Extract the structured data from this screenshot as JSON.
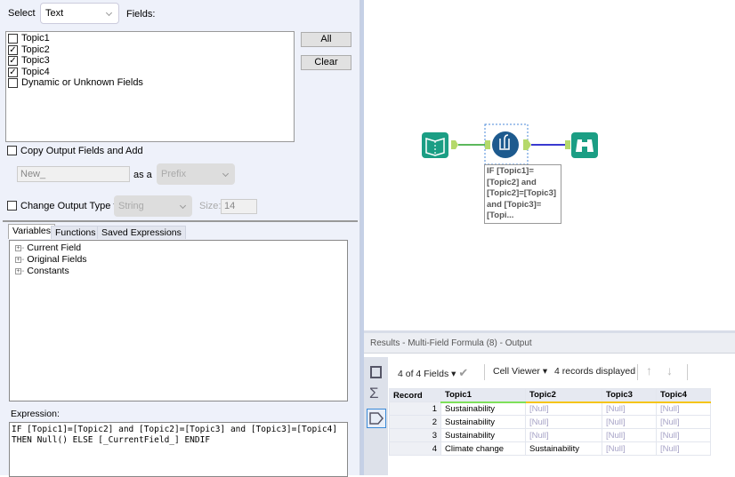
{
  "config": {
    "select_label": "Select",
    "select_value": "Text",
    "fields_label": "Fields:",
    "fields": [
      {
        "label": "Topic1",
        "checked": false
      },
      {
        "label": "Topic2",
        "checked": true
      },
      {
        "label": "Topic3",
        "checked": true
      },
      {
        "label": "Topic4",
        "checked": true
      },
      {
        "label": "Dynamic or Unknown Fields",
        "checked": false
      }
    ],
    "all_button": "All",
    "clear_button": "Clear",
    "copy_output_label": "Copy Output Fields and Add",
    "copy_output_checked": false,
    "new_field_value": "New_",
    "as_a_label": "as a",
    "prefix_value": "Prefix",
    "change_type_label": "Change Output Type to",
    "change_type_checked": false,
    "type_value": "String",
    "size_label": "Size:",
    "size_value": "14",
    "tabs": [
      "Variables",
      "Functions",
      "Saved Expressions"
    ],
    "tree": [
      "Current Field",
      "Original Fields",
      "Constants"
    ],
    "expression_label": "Expression:",
    "expression_line1": "IF [Topic1]=[Topic2] and [Topic2]=[Topic3] and [Topic3]=[Topic4]",
    "expression_line2": "THEN Null() ELSE [_CurrentField_] ENDIF"
  },
  "canvas": {
    "annotation": [
      "IF [Topic1]=",
      "[Topic2] and",
      "[Topic2]=[Topic3]",
      "and [Topic3]=",
      "[Topi..."
    ],
    "colors": {
      "tool_teal": "#1b9e84",
      "formula_blue": "#1d5a8e",
      "anchor": "#b5d96b",
      "line_in": "#5cb85c",
      "line_out": "#3a3ad0"
    }
  },
  "results": {
    "title": "Results - Multi-Field Formula (8) - Output",
    "fields_dropdown": "4 of 4 Fields",
    "cell_viewer": "Cell Viewer",
    "records_displayed": "4 records displayed",
    "columns": [
      "Record",
      "Topic1",
      "Topic2",
      "Topic3",
      "Topic4"
    ],
    "rows": [
      [
        "1",
        "Sustainability",
        "[Null]",
        "[Null]",
        "[Null]"
      ],
      [
        "2",
        "Sustainability",
        "[Null]",
        "[Null]",
        "[Null]"
      ],
      [
        "3",
        "Sustainability",
        "[Null]",
        "[Null]",
        "[Null]"
      ],
      [
        "4",
        "Climate change",
        "Sustainability",
        "[Null]",
        "[Null]"
      ]
    ]
  }
}
